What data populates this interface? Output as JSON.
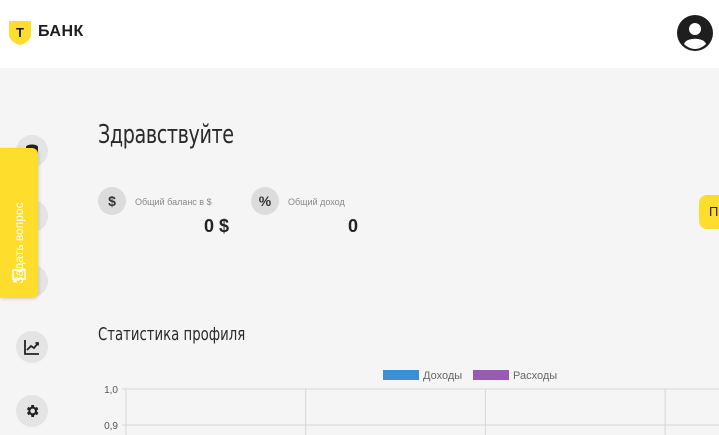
{
  "header": {
    "brand": "БАНК",
    "logo_letter": "Т"
  },
  "ask_tab": {
    "label": "Задать вопрос"
  },
  "greeting": "Здравствуйте",
  "stats": [
    {
      "icon": "$",
      "label": "Общий баланс в $",
      "value": "0 $"
    },
    {
      "icon": "%",
      "label": "Общий доход",
      "value": "0"
    }
  ],
  "yellow_button": {
    "label": "П"
  },
  "profile_stats": {
    "title": "Статистика профиля"
  },
  "chart_data": {
    "type": "bar",
    "categories": [],
    "series": [
      {
        "name": "Доходы",
        "color": "#3d8fd1",
        "values": []
      },
      {
        "name": "Расходы",
        "color": "#9b59b6",
        "values": []
      }
    ],
    "y_ticks": [
      "1,0",
      "0,9"
    ],
    "ylim": [
      0,
      1
    ],
    "grid": true,
    "legend": "top-center"
  },
  "colors": {
    "accent": "#ffdd2d",
    "income": "#3d8fd1",
    "expense": "#9b59b6"
  },
  "icons": {
    "rail": [
      "stack-icon",
      "wallet-icon",
      "cards-icon",
      "chart-line-icon",
      "gear-icon"
    ]
  }
}
